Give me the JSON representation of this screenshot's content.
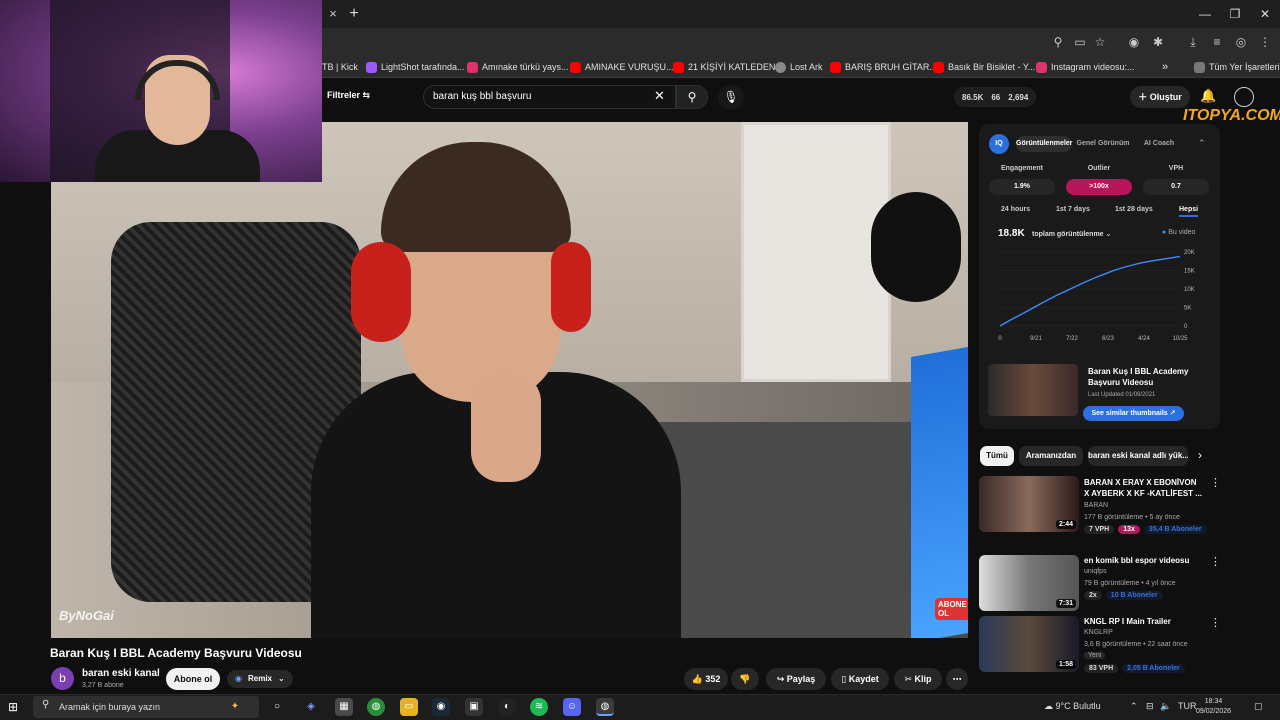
{
  "browser": {
    "tab_close": "×",
    "new_tab": "+",
    "window_controls": [
      "—",
      "❐",
      "✕"
    ],
    "bookmarks": [
      {
        "label": "TB | Kick",
        "color": "#2b2b2b"
      },
      {
        "label": "LightShot tarafında...",
        "color": "#9b59ff"
      },
      {
        "label": "Amınake türkü yays...",
        "color": "#e1306c"
      },
      {
        "label": "AMINAKE VURUŞU...",
        "color": "#ff0000"
      },
      {
        "label": "21 KİŞİYİ KATLEDEN...",
        "color": "#ff0000"
      },
      {
        "label": "Lost Ark",
        "color": "#888888"
      },
      {
        "label": "BARIŞ BRUH GİTAR...",
        "color": "#ff0000"
      },
      {
        "label": "Basık Bir Bisiklet - Y...",
        "color": "#ff0000"
      },
      {
        "label": "Instagram videosu:...",
        "color": "#e1306c"
      }
    ],
    "bookmarks_more": "»",
    "all_bookmarks": "Tüm Yer İşaretleri"
  },
  "youtube": {
    "filters_label": "Filtreler",
    "search_value": "baran kuş bbl başvuru",
    "stats": [
      "86.5K",
      "66",
      "2,694"
    ],
    "create_label": "Oluştur",
    "watermark": "ITOPYA.COM"
  },
  "video": {
    "title": "Baran Kuş I BBL Academy Başvuru Videosu",
    "overlay_logo": "ByNoGai",
    "overlay_badge": "ABONE OL",
    "channel_initial": "b",
    "channel_name": "baran eski kanal",
    "subscribers": "3,27 B abone",
    "subscribe_label": "Abone ol",
    "remix_label": "Remix",
    "likes": "352",
    "share_label": "Paylaş",
    "save_label": "Kaydet",
    "clip_label": "Klip"
  },
  "analytics": {
    "logo": "IQ",
    "tabs": [
      "Görüntülenmeler",
      "Genel Görünüm",
      "AI Coach"
    ],
    "metrics": [
      {
        "label": "Engagement",
        "value": "1.9%"
      },
      {
        "label": "Outlier",
        "value": ">100x"
      },
      {
        "label": "VPH",
        "value": "0.7"
      }
    ],
    "ranges": [
      "24 hours",
      "1st 7 days",
      "1st 28 days",
      "Hepsi"
    ],
    "total_views": "18.8K",
    "views_label": "toplam görüntülenme",
    "legend": "Bu video",
    "thumb_title": "Baran Kuş I BBL Academy Başvuru Videosu",
    "thumb_date": "Last Updated 01/08/2021",
    "similar_label": "See similar thumbnails"
  },
  "chart_data": {
    "type": "line",
    "x_tick_labels": [
      "0",
      "9/21",
      "7/22",
      "6/23",
      "4/24",
      "10/25"
    ],
    "y_tick_labels": [
      "0",
      "5K",
      "10K",
      "15K",
      "20K"
    ],
    "ylim": [
      0,
      20000
    ],
    "series": [
      {
        "name": "Bu video",
        "values": [
          0,
          1500,
          2800,
          4200,
          5600,
          7000,
          8300,
          9500,
          10700,
          11900,
          13000,
          14000,
          15000,
          15800,
          16500,
          17100,
          17600,
          18000,
          18400,
          18800
        ]
      }
    ]
  },
  "chips": [
    "Tümü",
    "Aramanızdan",
    "baran eski kanal adlı yük..."
  ],
  "related": [
    {
      "title": "BARAN X ERAY X EBONİVON X AYBERK X KF -KATLİFEST ...",
      "channel": "BARAN",
      "meta": "177 B görüntüleme • 5 ay önce",
      "duration": "2:44",
      "tags": [
        "7 VPH",
        "13x",
        "35,4 B Aboneler"
      ]
    },
    {
      "title": "en komik bbl espor videosu",
      "channel": "uniqfps",
      "meta": "79 B görüntüleme • 4 yıl önce",
      "duration": "7:31",
      "tags": [
        "2x",
        "10 B Aboneler"
      ]
    },
    {
      "title": "KNGL RP I Main Trailer",
      "channel": "KNGLRP",
      "meta": "3,6 B görüntüleme • 22 saat önce",
      "extra": "Yeni",
      "duration": "1:58",
      "tags": [
        "83 VPH",
        "2,05 B Aboneler"
      ]
    }
  ],
  "taskbar": {
    "search_placeholder": "Aramak için buraya yazın",
    "weather": "9°C Bulutlu",
    "lang": "TUR",
    "time": "18:34",
    "date": "09/02/2026"
  }
}
